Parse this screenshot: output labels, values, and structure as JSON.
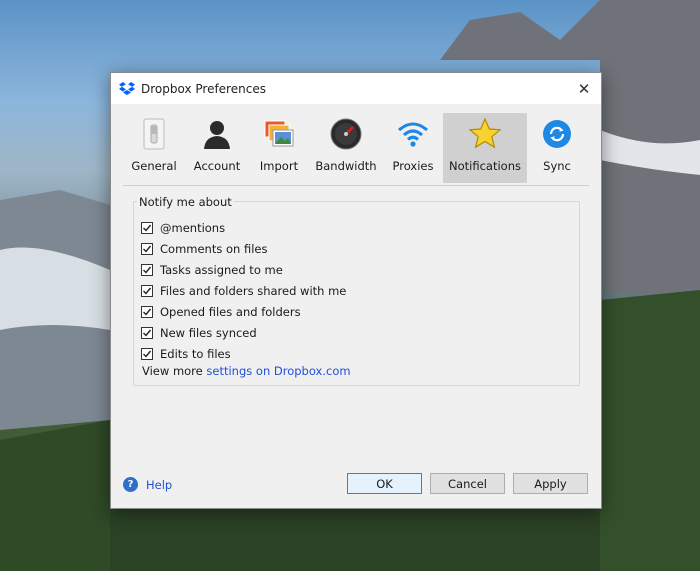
{
  "window": {
    "title": "Dropbox Preferences",
    "close_glyph": "✕"
  },
  "tabs": [
    {
      "label": "General",
      "icon": "switch-icon"
    },
    {
      "label": "Account",
      "icon": "person-icon"
    },
    {
      "label": "Import",
      "icon": "photos-icon"
    },
    {
      "label": "Bandwidth",
      "icon": "gauge-icon"
    },
    {
      "label": "Proxies",
      "icon": "wifi-icon"
    },
    {
      "label": "Notifications",
      "icon": "star-icon",
      "active": true
    },
    {
      "label": "Sync",
      "icon": "sync-icon"
    }
  ],
  "notifications": {
    "group_title": "Notify me about",
    "items": [
      {
        "label": "@mentions",
        "checked": true
      },
      {
        "label": "Comments on files",
        "checked": true
      },
      {
        "label": "Tasks assigned to me",
        "checked": true
      },
      {
        "label": "Files and folders shared with me",
        "checked": true
      },
      {
        "label": "Opened files and folders",
        "checked": true
      },
      {
        "label": "New files synced",
        "checked": true
      },
      {
        "label": "Edits to files",
        "checked": true
      }
    ],
    "view_more_prefix": "View more",
    "view_more_link": "settings on Dropbox.com"
  },
  "footer": {
    "help_label": "Help",
    "help_glyph": "?",
    "ok_label": "OK",
    "cancel_label": "Cancel",
    "apply_label": "Apply"
  },
  "colors": {
    "accent": "#3b7ddb",
    "link": "#1f4fd6",
    "dropbox_blue": "#0061fe"
  }
}
